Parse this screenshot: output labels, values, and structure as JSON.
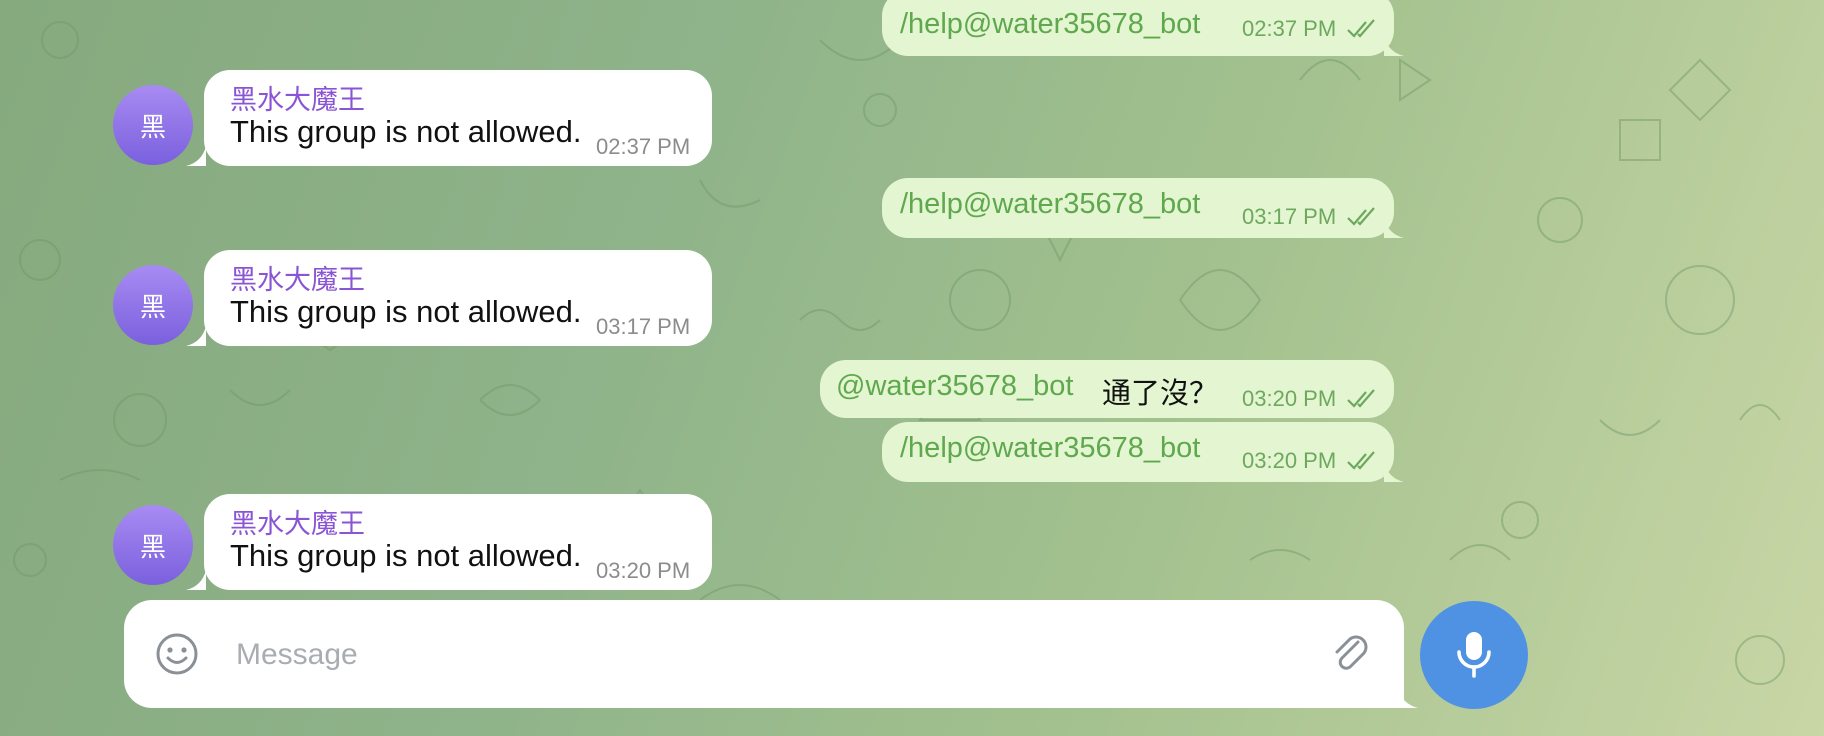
{
  "messages": [
    {
      "direction": "out",
      "command": "/help@water35678_bot",
      "time": "02:37 PM"
    },
    {
      "direction": "in",
      "sender": "黑水大魔王",
      "avatar_letter": "黑",
      "text": "This group is not allowed.",
      "time": "02:37 PM"
    },
    {
      "direction": "out",
      "command": "/help@water35678_bot",
      "time": "03:17 PM"
    },
    {
      "direction": "in",
      "sender": "黑水大魔王",
      "avatar_letter": "黑",
      "text": "This group is not allowed.",
      "time": "03:17 PM"
    },
    {
      "direction": "out",
      "mention": "@water35678_bot",
      "text": "通了沒？",
      "time": "03:20 PM"
    },
    {
      "direction": "out",
      "command": "/help@water35678_bot",
      "time": "03:20 PM"
    },
    {
      "direction": "in",
      "sender": "黑水大魔王",
      "avatar_letter": "黑",
      "text": "This group is not allowed.",
      "time": "03:20 PM"
    }
  ],
  "composer": {
    "placeholder": "Message",
    "value": "",
    "emoji_icon": "smiley-icon",
    "attach_icon": "paperclip-icon",
    "send_icon": "microphone-icon"
  },
  "colors": {
    "outgoing_bubble": "#e3f6d1",
    "outgoing_accent": "#5fa84e",
    "incoming_bubble": "#ffffff",
    "sender_name": "#8a55d4",
    "avatar": "#8a6fe8",
    "mic_button": "#4f92e3"
  }
}
